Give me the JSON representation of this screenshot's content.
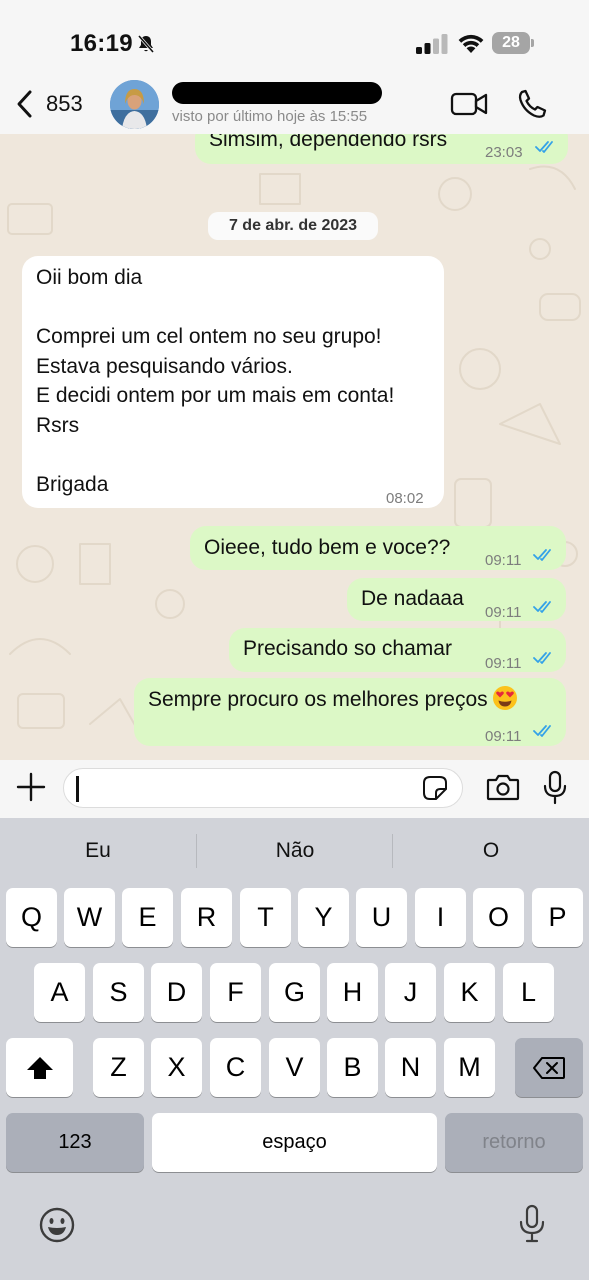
{
  "status_bar": {
    "time": "16:19",
    "battery": "28"
  },
  "header": {
    "back_count": "853",
    "last_seen": "visto por último hoje às 15:55"
  },
  "chat": {
    "date_chip": "7 de abr. de 2023",
    "messages": [
      {
        "dir": "out",
        "lines": [
          "Simsim, dependendo rsrs"
        ],
        "time": "23:03"
      },
      {
        "dir": "in",
        "lines": [
          "Oii bom dia",
          "",
          "Comprei um cel ontem no seu grupo!",
          "Estava pesquisando vários.",
          "E decidi ontem por um mais em conta!",
          "Rsrs",
          "",
          "Brigada"
        ],
        "time": "08:02"
      },
      {
        "dir": "out",
        "lines": [
          "Oieee, tudo bem e voce??"
        ],
        "time": "09:11"
      },
      {
        "dir": "out",
        "lines": [
          "De nadaaa"
        ],
        "time": "09:11"
      },
      {
        "dir": "out",
        "lines": [
          "Precisando so chamar"
        ],
        "time": "09:11"
      },
      {
        "dir": "out",
        "lines": [
          "Sempre procuro os melhores preços"
        ],
        "emoji": "heart-eyes-emoji",
        "time": "09:11"
      }
    ]
  },
  "keyboard": {
    "suggestions": [
      "Eu",
      "Não",
      "O"
    ],
    "row1": [
      "Q",
      "W",
      "E",
      "R",
      "T",
      "Y",
      "U",
      "I",
      "O",
      "P"
    ],
    "row2": [
      "A",
      "S",
      "D",
      "F",
      "G",
      "H",
      "J",
      "K",
      "L"
    ],
    "row3": [
      "Z",
      "X",
      "C",
      "V",
      "B",
      "N",
      "M"
    ],
    "numbers_key": "123",
    "space_key": "espaço",
    "return_key": "retorno"
  },
  "colors": {
    "outgoing_bubble": "#dcf8c6",
    "incoming_bubble": "#ffffff",
    "chat_background": "#efe7dc",
    "read_ticks": "#34a2e8",
    "keyboard_background": "#d1d3d9"
  },
  "icons": [
    "bell-slash-icon",
    "signal-icon",
    "wifi-icon",
    "battery-icon",
    "back-chevron-icon",
    "video-call-icon",
    "phone-icon",
    "plus-icon",
    "sticker-icon",
    "camera-icon",
    "microphone-icon",
    "shift-icon",
    "backspace-icon",
    "emoji-icon",
    "dictation-icon",
    "double-check-icon"
  ]
}
